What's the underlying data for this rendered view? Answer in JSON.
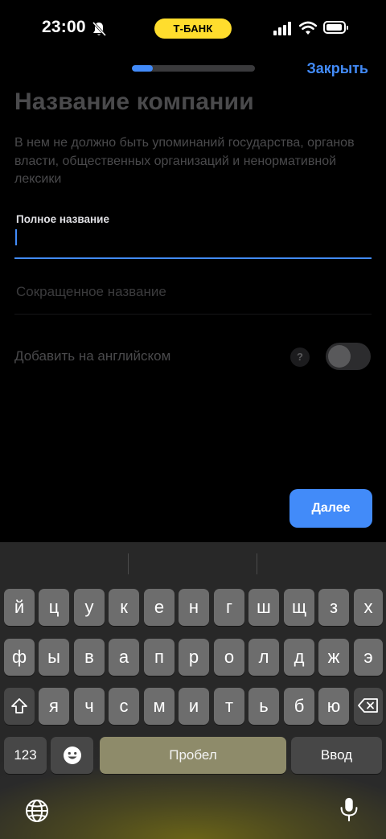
{
  "status_bar": {
    "time": "23:00",
    "carrier_badge": "Т-БАНК",
    "carrier_badge_color": "#ffdd2d",
    "icons": [
      "bell-slash-icon",
      "signal-icon",
      "wifi-icon",
      "battery-icon"
    ]
  },
  "header": {
    "progress": 0.17,
    "close_label": "Закрыть",
    "accent_color": "#428bf9"
  },
  "form": {
    "title": "Название компании",
    "subtitle": "В нем не должно быть упоминаний государства, органов власти, общественных организаций и ненормативной лексики",
    "full_name": {
      "label": "Полное название",
      "value": ""
    },
    "short_name": {
      "placeholder": "Сокращенное название",
      "value": ""
    },
    "english": {
      "label": "Добавить на английском",
      "help": "?",
      "enabled": false
    },
    "next_label": "Далее"
  },
  "keyboard": {
    "rows": [
      [
        "й",
        "ц",
        "у",
        "к",
        "е",
        "н",
        "г",
        "ш",
        "щ",
        "з",
        "х"
      ],
      [
        "ф",
        "ы",
        "в",
        "а",
        "п",
        "р",
        "о",
        "л",
        "д",
        "ж",
        "э"
      ],
      [
        "я",
        "ч",
        "с",
        "м",
        "и",
        "т",
        "ь",
        "б",
        "ю"
      ]
    ],
    "numbers_label": "123",
    "space_label": "Пробел",
    "return_label": "Ввод",
    "icons": [
      "shift-icon",
      "backspace-icon",
      "emoji-icon",
      "globe-icon",
      "mic-icon"
    ]
  }
}
